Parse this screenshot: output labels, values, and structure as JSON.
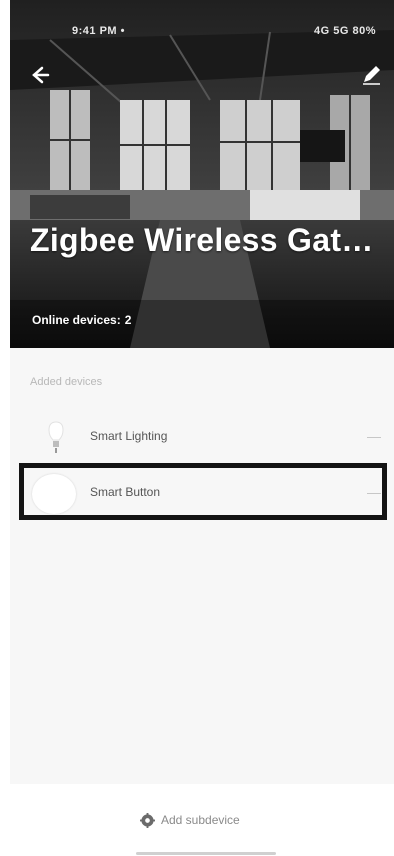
{
  "status_bar": {
    "time": "9:41 PM •",
    "right": "4G 5G 80%"
  },
  "header": {
    "title": "Zigbee Wireless Gat…",
    "online_label": "Online devices:",
    "online_count": "2"
  },
  "section": {
    "label": "Added devices"
  },
  "devices": [
    {
      "name": "Smart Lighting",
      "icon": "bulb-icon",
      "more": "—"
    },
    {
      "name": "Smart Button",
      "icon": "button-icon",
      "more": "—"
    }
  ],
  "footer": {
    "add_label": "Add subdevice",
    "icon": "gear-icon"
  },
  "colors": {
    "highlight": "#141414",
    "hero_bg": "#2a2a2a",
    "muted_text": "#b8b8b8"
  }
}
